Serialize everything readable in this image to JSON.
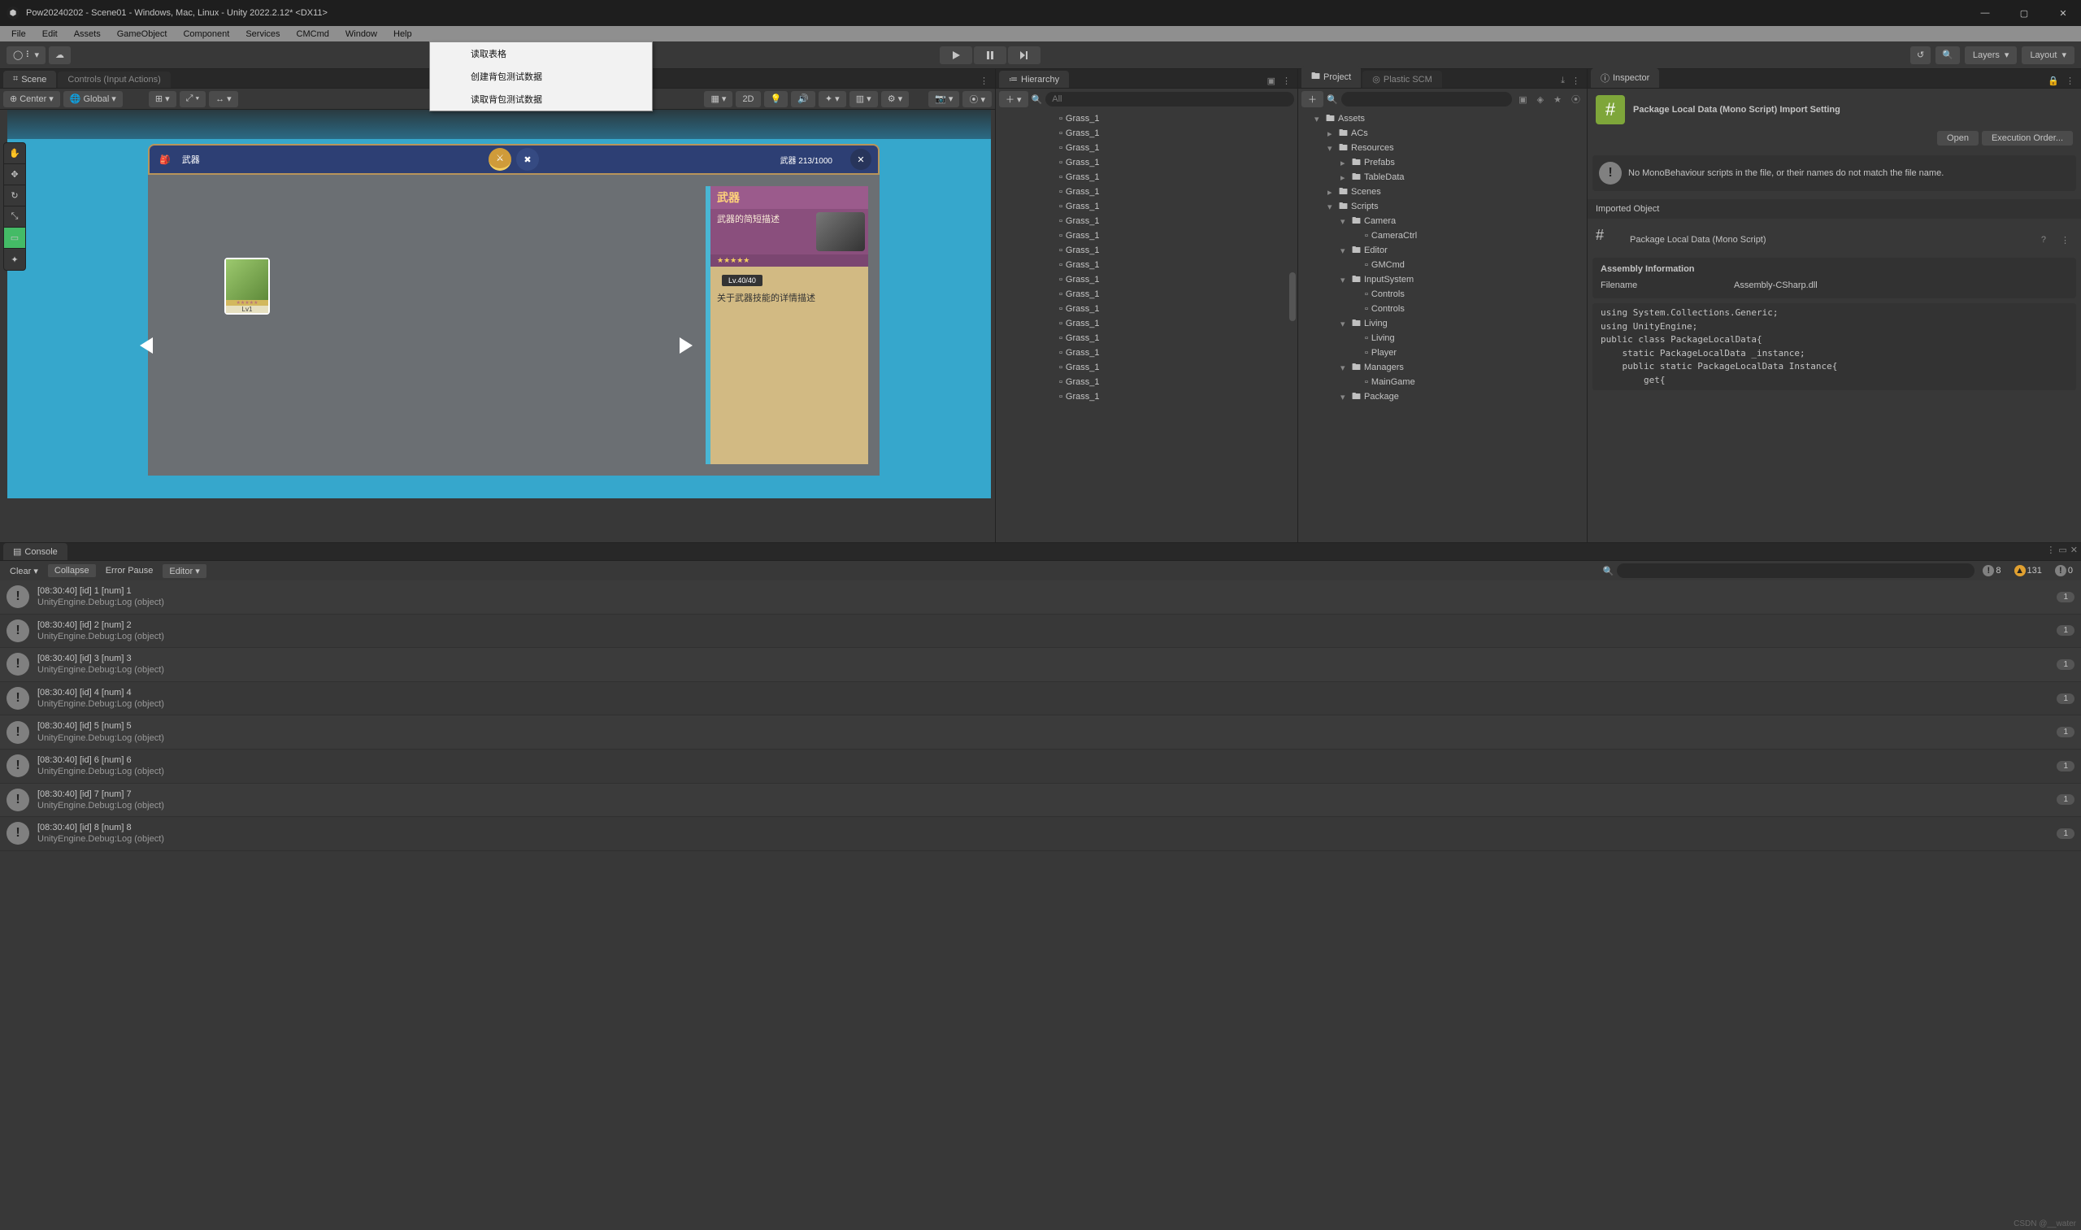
{
  "window": {
    "title": "Pow20240202 - Scene01 - Windows, Mac, Linux - Unity 2022.2.12* <DX11>"
  },
  "menubar": [
    "File",
    "Edit",
    "Assets",
    "GameObject",
    "Component",
    "Services",
    "CMCmd",
    "Window",
    "Help"
  ],
  "dropdown": {
    "items": [
      "读取表格",
      "创建背包测试数据",
      "读取背包测试数据"
    ]
  },
  "topbar": {
    "layers": "Layers",
    "layout": "Layout"
  },
  "scene": {
    "tabs": [
      "Scene",
      "Controls (Input Actions)"
    ],
    "toolbar": {
      "center": "Center",
      "global": "Global",
      "mode2d": "2D"
    },
    "game": {
      "headerLabel": "武器",
      "count": "武器 213/1000",
      "item": {
        "lvl": "Lv1",
        "stars": "★★★★★"
      },
      "detail": {
        "title": "武器",
        "subtitle": "武器的简短描述",
        "stars": "★★★★★",
        "lv": "Lv.40/40",
        "desc": "关于武器技能的详情描述"
      }
    }
  },
  "hierarchy": {
    "tab": "Hierarchy",
    "searchPlaceholder": "All",
    "items": [
      "Grass_1",
      "Grass_1",
      "Grass_1",
      "Grass_1",
      "Grass_1",
      "Grass_1",
      "Grass_1",
      "Grass_1",
      "Grass_1",
      "Grass_1",
      "Grass_1",
      "Grass_1",
      "Grass_1",
      "Grass_1",
      "Grass_1",
      "Grass_1",
      "Grass_1",
      "Grass_1",
      "Grass_1",
      "Grass_1"
    ]
  },
  "project": {
    "tabs": [
      "Project",
      "Plastic SCM"
    ],
    "tree": [
      {
        "ind": 1,
        "open": true,
        "label": "Assets",
        "folder": 1
      },
      {
        "ind": 2,
        "open": false,
        "label": "ACs",
        "folder": 1
      },
      {
        "ind": 2,
        "open": true,
        "label": "Resources",
        "folder": 1
      },
      {
        "ind": 3,
        "open": false,
        "label": "Prefabs",
        "folder": 1
      },
      {
        "ind": 3,
        "open": false,
        "label": "TableData",
        "folder": 1
      },
      {
        "ind": 2,
        "open": false,
        "label": "Scenes",
        "folder": 1
      },
      {
        "ind": 2,
        "open": true,
        "label": "Scripts",
        "folder": 1
      },
      {
        "ind": 3,
        "open": true,
        "label": "Camera",
        "folder": 1
      },
      {
        "ind": 4,
        "open": null,
        "label": "CameraCtrl",
        "folder": 0
      },
      {
        "ind": 3,
        "open": true,
        "label": "Editor",
        "folder": 1
      },
      {
        "ind": 4,
        "open": null,
        "label": "GMCmd",
        "folder": 0
      },
      {
        "ind": 3,
        "open": true,
        "label": "InputSystem",
        "folder": 1
      },
      {
        "ind": 4,
        "open": null,
        "label": "Controls",
        "folder": 0
      },
      {
        "ind": 4,
        "open": null,
        "label": "Controls",
        "folder": 0
      },
      {
        "ind": 3,
        "open": true,
        "label": "Living",
        "folder": 1
      },
      {
        "ind": 4,
        "open": null,
        "label": "Living",
        "folder": 0
      },
      {
        "ind": 4,
        "open": null,
        "label": "Player",
        "folder": 0
      },
      {
        "ind": 3,
        "open": true,
        "label": "Managers",
        "folder": 1
      },
      {
        "ind": 4,
        "open": null,
        "label": "MainGame",
        "folder": 0
      },
      {
        "ind": 3,
        "open": true,
        "label": "Package",
        "folder": 1
      }
    ]
  },
  "inspector": {
    "tab": "Inspector",
    "title": "Package Local Data (Mono Script) Import Setting",
    "openBtn": "Open",
    "execOrderBtn": "Execution Order...",
    "warn": "No MonoBehaviour scripts in the file, or their names do not match the file name.",
    "importedObject": "Imported Object",
    "objName": "Package Local Data (Mono Script)",
    "assemblyInfo": "Assembly Information",
    "filenameLabel": "Filename",
    "filenameValue": "Assembly-CSharp.dll",
    "code": [
      "using System.Collections.Generic;",
      "using UnityEngine;",
      "public class PackageLocalData{",
      "    static PackageLocalData _instance;",
      "    public static PackageLocalData Instance{",
      "        get{"
    ]
  },
  "console": {
    "tab": "Console",
    "buttons": {
      "clear": "Clear",
      "collapse": "Collapse",
      "errorPause": "Error Pause",
      "editor": "Editor"
    },
    "counts": {
      "info": "8",
      "warn": "131",
      "err": "0"
    },
    "logs": [
      {
        "h": "[08:30:40] [id] 1 [num] 1",
        "s": "UnityEngine.Debug:Log (object)",
        "c": "1"
      },
      {
        "h": "[08:30:40] [id] 2 [num] 2",
        "s": "UnityEngine.Debug:Log (object)",
        "c": "1"
      },
      {
        "h": "[08:30:40] [id] 3 [num] 3",
        "s": "UnityEngine.Debug:Log (object)",
        "c": "1"
      },
      {
        "h": "[08:30:40] [id] 4 [num] 4",
        "s": "UnityEngine.Debug:Log (object)",
        "c": "1"
      },
      {
        "h": "[08:30:40] [id] 5 [num] 5",
        "s": "UnityEngine.Debug:Log (object)",
        "c": "1"
      },
      {
        "h": "[08:30:40] [id] 6 [num] 6",
        "s": "UnityEngine.Debug:Log (object)",
        "c": "1"
      },
      {
        "h": "[08:30:40] [id] 7 [num] 7",
        "s": "UnityEngine.Debug:Log (object)",
        "c": "1"
      },
      {
        "h": "[08:30:40] [id] 8 [num] 8",
        "s": "UnityEngine.Debug:Log (object)",
        "c": "1"
      }
    ]
  },
  "watermark": "CSDN @__water"
}
